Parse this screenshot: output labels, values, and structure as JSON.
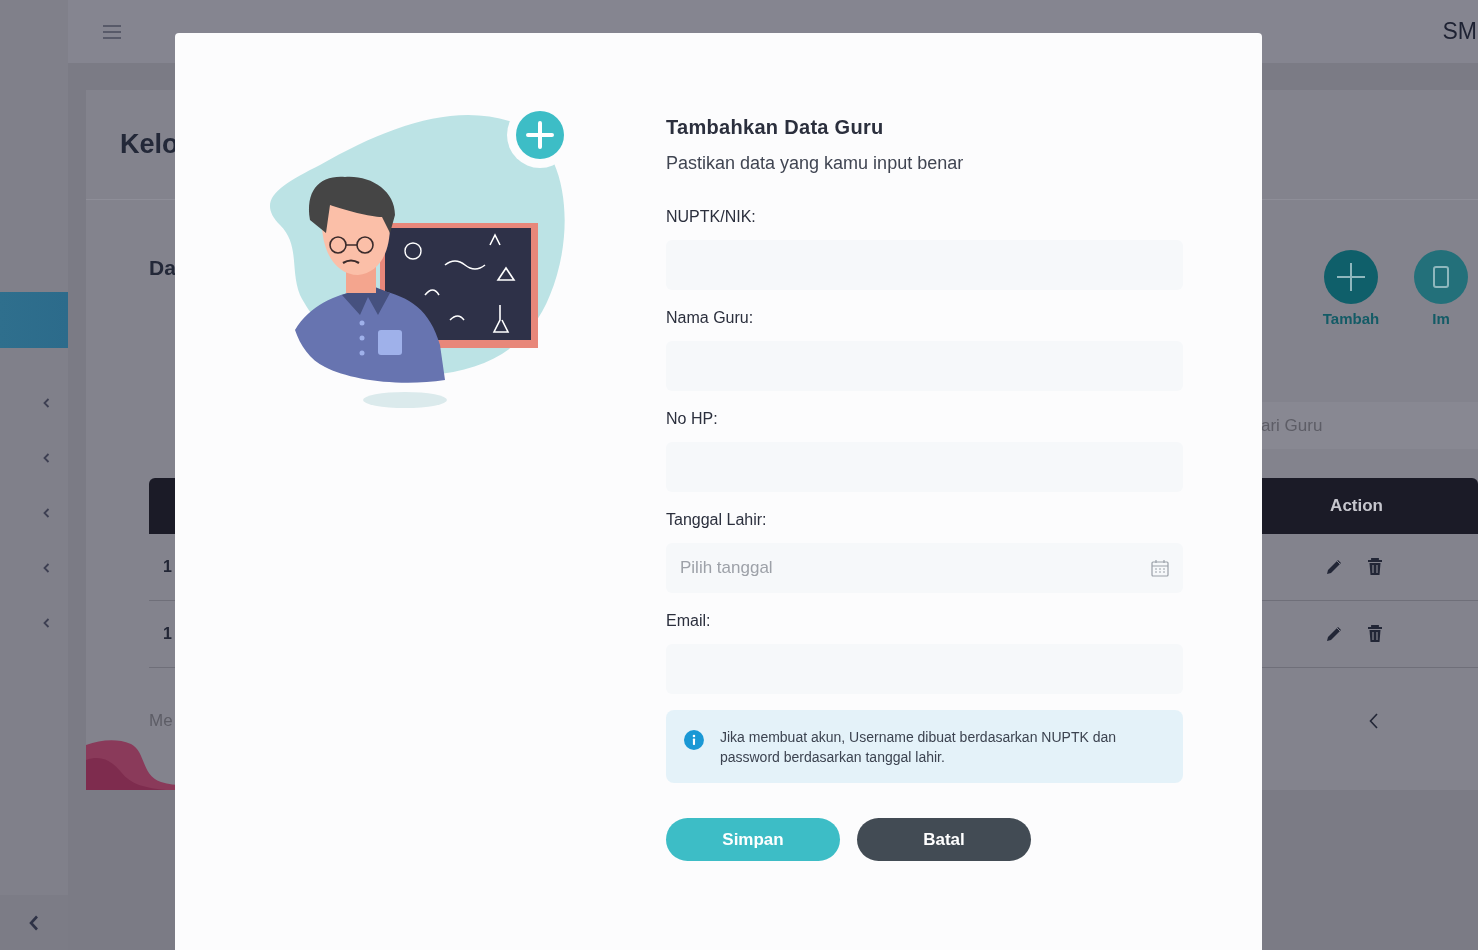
{
  "sidebar": {
    "items": [
      {
        "selected": true
      },
      {
        "selected": false
      },
      {
        "selected": false
      },
      {
        "selected": false
      },
      {
        "selected": false
      },
      {
        "selected": false
      }
    ]
  },
  "topbar": {
    "brand": "SM"
  },
  "page": {
    "title": "Kelo",
    "section_title": "Da",
    "actions": [
      {
        "label": "Tambah",
        "kind": "add"
      },
      {
        "label": "Im",
        "kind": "import"
      }
    ],
    "search": {
      "placeholder": "ari Guru"
    },
    "table": {
      "columns": [
        "Action"
      ],
      "rows": [
        {
          "cells": [
            "1"
          ]
        },
        {
          "cells": [
            "1"
          ]
        }
      ]
    },
    "footer_text": "Me"
  },
  "modal": {
    "title": "Tambahkan Data Guru",
    "subtitle": "Pastikan data yang kamu input benar",
    "fields": [
      {
        "label": "NUPTK/NIK:",
        "kind": "text"
      },
      {
        "label": "Nama Guru:",
        "kind": "text"
      },
      {
        "label": "No HP:",
        "kind": "text"
      },
      {
        "label": "Tanggal Lahir:",
        "kind": "date",
        "placeholder": "Pilih tanggal"
      },
      {
        "label": "Email:",
        "kind": "text"
      }
    ],
    "info": "Jika membuat akun, Username dibuat berdasarkan NUPTK dan password berdasarkan tanggal lahir.",
    "buttons": [
      {
        "label": "Simpan",
        "kind": "primary"
      },
      {
        "label": "Batal",
        "kind": "secondary"
      }
    ]
  }
}
